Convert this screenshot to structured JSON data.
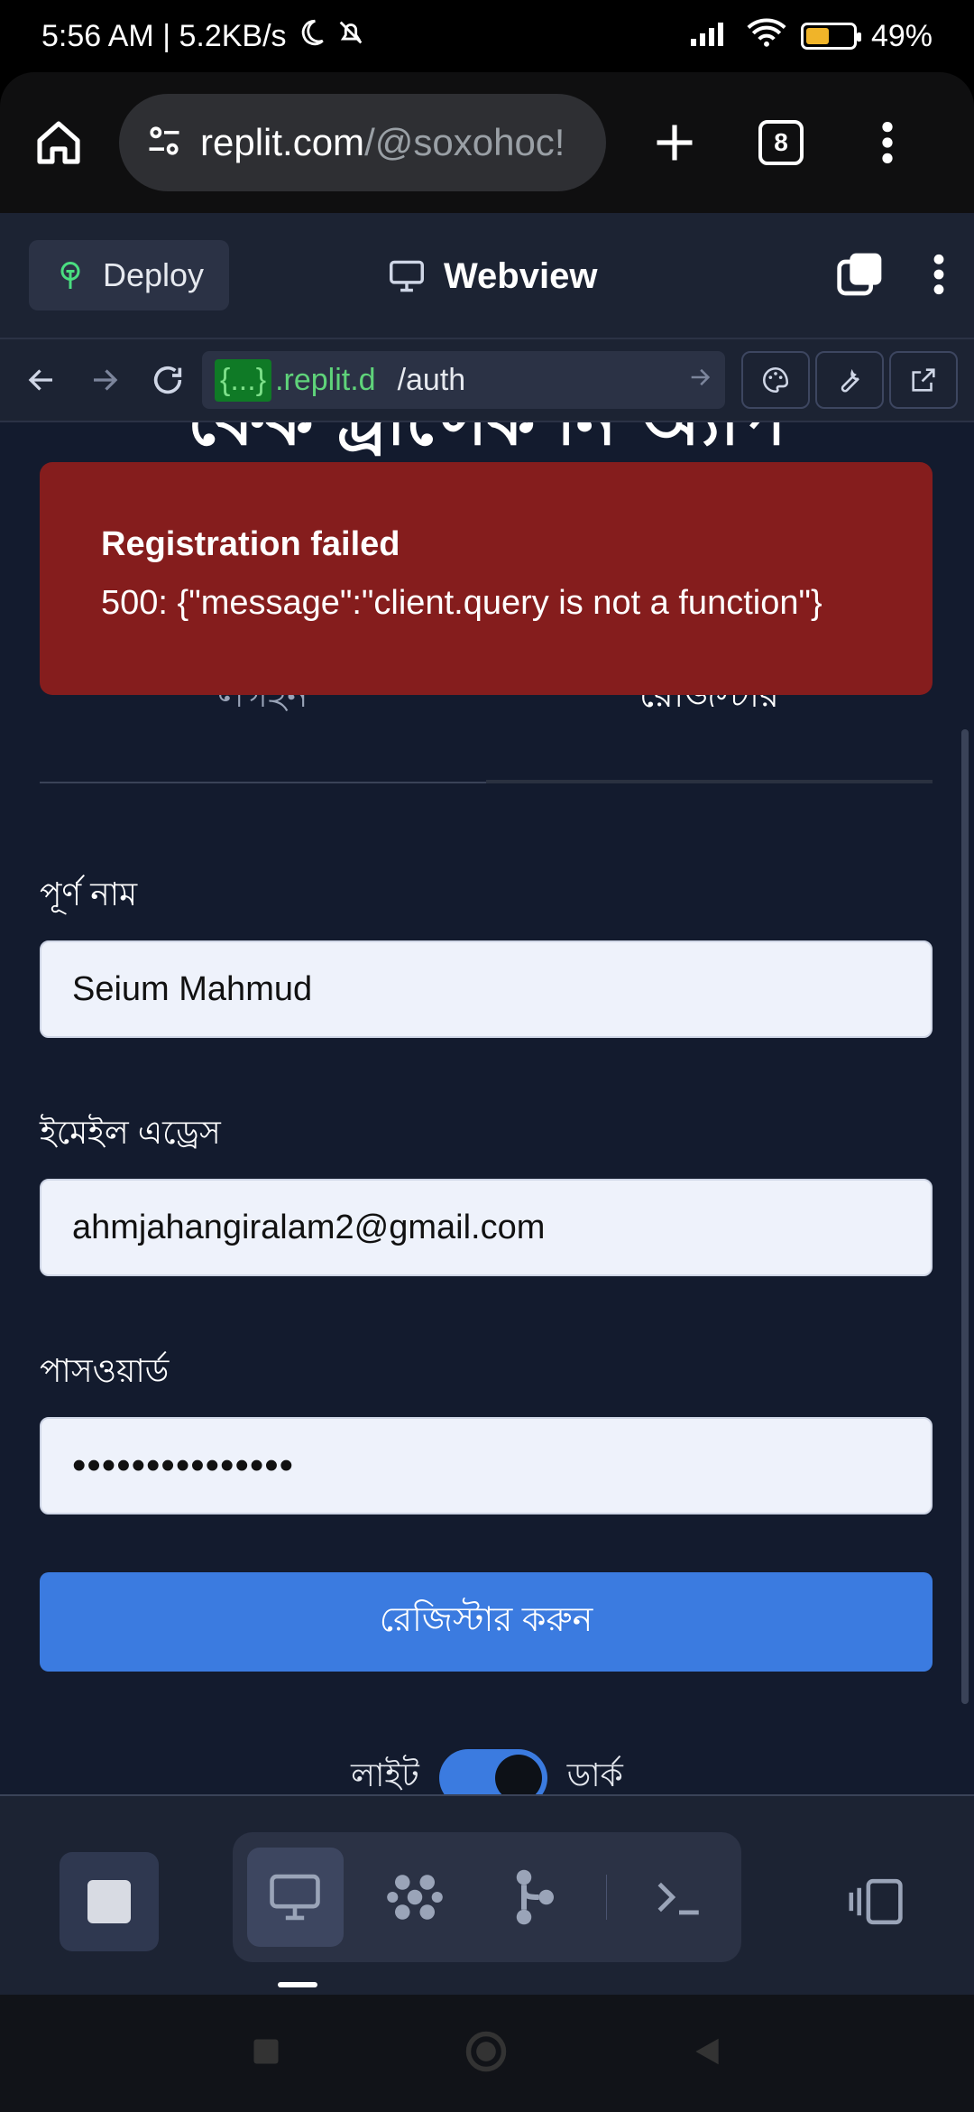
{
  "status_bar": {
    "time_speed": "5:56 AM | 5.2KB/s",
    "battery": "49%",
    "battery_level": 0.49
  },
  "browser": {
    "url_host": "replit.com",
    "url_path": "/@soxohoc!",
    "tab_count": "8"
  },
  "replit_header": {
    "deploy_label": "Deploy",
    "webview_label": "Webview"
  },
  "webview_nav": {
    "subdomain": "{...}",
    "domain": ".replit.d",
    "path": "/auth"
  },
  "page": {
    "title": "ফেক ট্রান্সেকশন অ্যাপ",
    "tabs": [
      {
        "label": "লগইন"
      },
      {
        "label": "রেজিস্টার"
      }
    ],
    "fields": {
      "name_label": "পূর্ণ নাম",
      "name_value": "Seium Mahmud",
      "email_label": "ইমেইল এড্রেস",
      "email_value": "ahmjahangiralam2@gmail.com",
      "password_label": "পাসওয়ার্ড",
      "password_value": "•••••••••••••••"
    },
    "submit_label": "রেজিস্টার করুন",
    "theme": {
      "light_label": "লাইট",
      "dark_label": "ডার্ক"
    }
  },
  "toast": {
    "title": "Registration failed",
    "message": "500: {\"message\":\"client.query is not a function\"}"
  }
}
